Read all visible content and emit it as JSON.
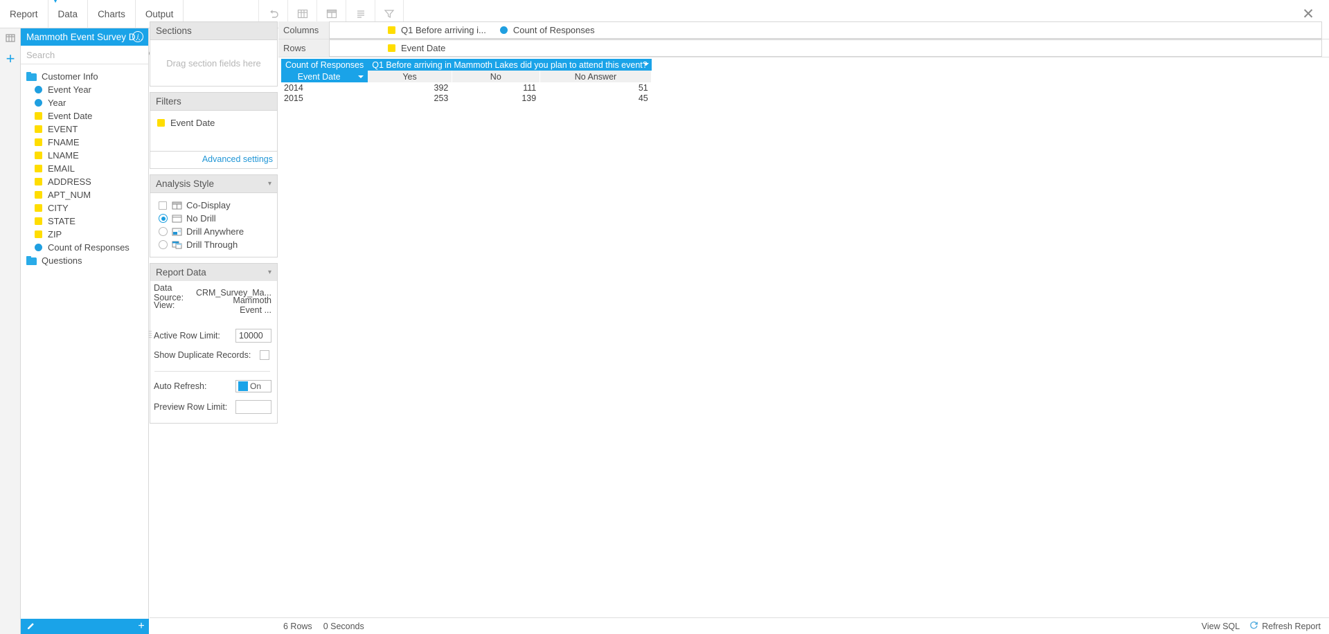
{
  "menubar": {
    "items": [
      "Report",
      "Data",
      "Charts",
      "Output"
    ],
    "tools": [
      {
        "name": "undo-icon",
        "title": "Undo"
      },
      {
        "name": "table-icon",
        "title": "Table"
      },
      {
        "name": "crosstab-icon",
        "title": "Crosstab"
      },
      {
        "name": "list-icon",
        "title": "List"
      },
      {
        "name": "filter-icon",
        "title": "Filter"
      }
    ],
    "close_label": "✕"
  },
  "rail": {
    "grid_icon": "grid-icon",
    "add_label": "+"
  },
  "datasource": {
    "title": "Mammoth Event Survey D...",
    "info_label": "i",
    "search": {
      "placeholder": "Search",
      "value": "",
      "icon": "search-icon"
    },
    "tree": [
      {
        "label": "Customer Info",
        "type": "folder",
        "level": 0
      },
      {
        "label": "Event Year",
        "type": "measure",
        "level": 1
      },
      {
        "label": "Year",
        "type": "measure",
        "level": 1
      },
      {
        "label": "Event Date",
        "type": "dimension",
        "level": 1
      },
      {
        "label": "EVENT",
        "type": "dimension",
        "level": 1
      },
      {
        "label": "FNAME",
        "type": "dimension",
        "level": 1
      },
      {
        "label": "LNAME",
        "type": "dimension",
        "level": 1
      },
      {
        "label": "EMAIL",
        "type": "dimension",
        "level": 1
      },
      {
        "label": "ADDRESS",
        "type": "dimension",
        "level": 1
      },
      {
        "label": "APT_NUM",
        "type": "dimension",
        "level": 1
      },
      {
        "label": "CITY",
        "type": "dimension",
        "level": 1
      },
      {
        "label": "STATE",
        "type": "dimension",
        "level": 1
      },
      {
        "label": "ZIP",
        "type": "dimension",
        "level": 1
      },
      {
        "label": "Count of Responses",
        "type": "measure",
        "level": 1
      },
      {
        "label": "Questions",
        "type": "folder",
        "level": 0
      }
    ],
    "footer": {
      "edit_icon": "pencil-icon",
      "add_label": "+"
    }
  },
  "sections_panel": {
    "title": "Sections",
    "drop_hint": "Drag section fields here"
  },
  "filters_panel": {
    "title": "Filters",
    "fields": [
      {
        "label": "Event Date",
        "type": "dimension"
      }
    ],
    "advanced_link": "Advanced settings"
  },
  "analysis_style": {
    "title": "Analysis Style",
    "chevron": "chevron-down-icon",
    "options": [
      {
        "label": "Co-Display",
        "control": "checkbox",
        "selected": false,
        "icon": "codisplay-icon"
      },
      {
        "label": "No Drill",
        "control": "radio",
        "selected": true,
        "icon": "nodrill-icon"
      },
      {
        "label": "Drill Anywhere",
        "control": "radio",
        "selected": false,
        "icon": "drillanywhere-icon"
      },
      {
        "label": "Drill Through",
        "control": "radio",
        "selected": false,
        "icon": "drillthrough-icon"
      }
    ]
  },
  "report_data": {
    "title": "Report Data",
    "chevron": "chevron-down-icon",
    "data_source_label": "Data Source:",
    "data_source_value": "CRM_Survey_Ma...",
    "view_label": "View:",
    "view_value": "Mammoth Event ...",
    "active_row_limit_label": "Active Row Limit:",
    "active_row_limit_value": "10000",
    "show_duplicate_label": "Show Duplicate Records:",
    "show_duplicate_checked": false,
    "auto_refresh_label": "Auto Refresh:",
    "auto_refresh_state": "On",
    "preview_row_limit_label": "Preview Row Limit:",
    "preview_row_limit_value": ""
  },
  "shelves": {
    "columns_label": "Columns",
    "columns_fields": [
      {
        "label": "Q1 Before arriving i...",
        "type": "dimension"
      },
      {
        "label": "Count of Responses",
        "type": "measure"
      }
    ],
    "rows_label": "Rows",
    "rows_fields": [
      {
        "label": "Event Date",
        "type": "dimension"
      }
    ]
  },
  "crosstab": {
    "measure_title": "Count of Responses",
    "column_title": "Q1 Before arriving in Mammoth Lakes did you plan to attend this event?",
    "corner_label": "Event Date",
    "column_headers": [
      "Yes",
      "No",
      "No Answer"
    ],
    "rows": [
      {
        "label": "2014",
        "values": [
          "392",
          "111",
          "51"
        ]
      },
      {
        "label": "2015",
        "values": [
          "253",
          "139",
          "45"
        ]
      }
    ]
  },
  "statusbar": {
    "rows_text": "6 Rows",
    "seconds_text": "0 Seconds",
    "view_sql_label": "View SQL",
    "refresh_label": "Refresh Report",
    "refresh_icon": "refresh-icon"
  },
  "colors": {
    "accent": "#1aa3e8",
    "dimension": "#ffdd00",
    "measure": "#1f9fe0",
    "panel_header": "#e7e7e7"
  }
}
